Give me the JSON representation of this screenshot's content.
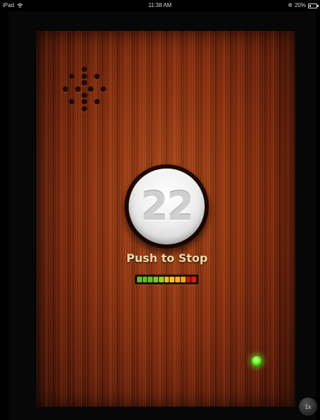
{
  "status_bar": {
    "device": "iPad",
    "time": "11:38 AM",
    "battery": "20%",
    "wifi_icon": "wifi-icon",
    "bluetooth_icon": "bluetooth-icon",
    "battery_icon": "battery-icon"
  },
  "main": {
    "counter": "22",
    "button_label": "Push to Stop",
    "speed_label": "1x",
    "indicator_color": "#3cff1a",
    "level_meter": {
      "segment_colors": [
        "#5fbf2a",
        "#5fbf2a",
        "#5fbf2a",
        "#7ac52a",
        "#9ccd2a",
        "#e0c020",
        "#f0c020",
        "#f5b318",
        "#f0a814",
        "#c81c10",
        "#d0200f"
      ]
    }
  }
}
